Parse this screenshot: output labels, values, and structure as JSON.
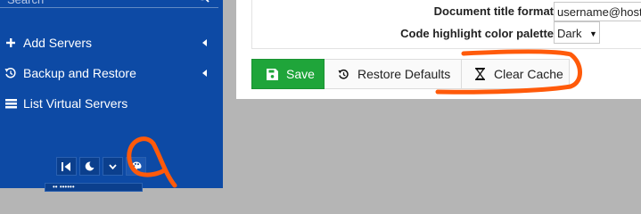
{
  "sidebar": {
    "search": {
      "placeholder": "Search"
    },
    "items": [
      {
        "label": "Add Servers",
        "icon": "plus-icon"
      },
      {
        "label": "Backup and Restore",
        "icon": "history-icon"
      },
      {
        "label": "List Virtual Servers",
        "icon": "server-list-icon"
      }
    ],
    "bottom_buttons": [
      "collapse-sidebar-icon",
      "moon-icon",
      "chevron-down-icon",
      "palette-icon"
    ]
  },
  "settings": {
    "document_title_format": {
      "label": "Document title format",
      "value": "username@hostname"
    },
    "code_highlight_palette": {
      "label": "Code highlight color palette",
      "value": "Dark"
    }
  },
  "buttons": {
    "save": "Save",
    "restore_defaults": "Restore Defaults",
    "clear_cache": "Clear Cache"
  },
  "colors": {
    "sidebar_bg": "#0d4aa5",
    "save_green": "#1fa53a",
    "annotation_orange": "#ff5a0a"
  }
}
